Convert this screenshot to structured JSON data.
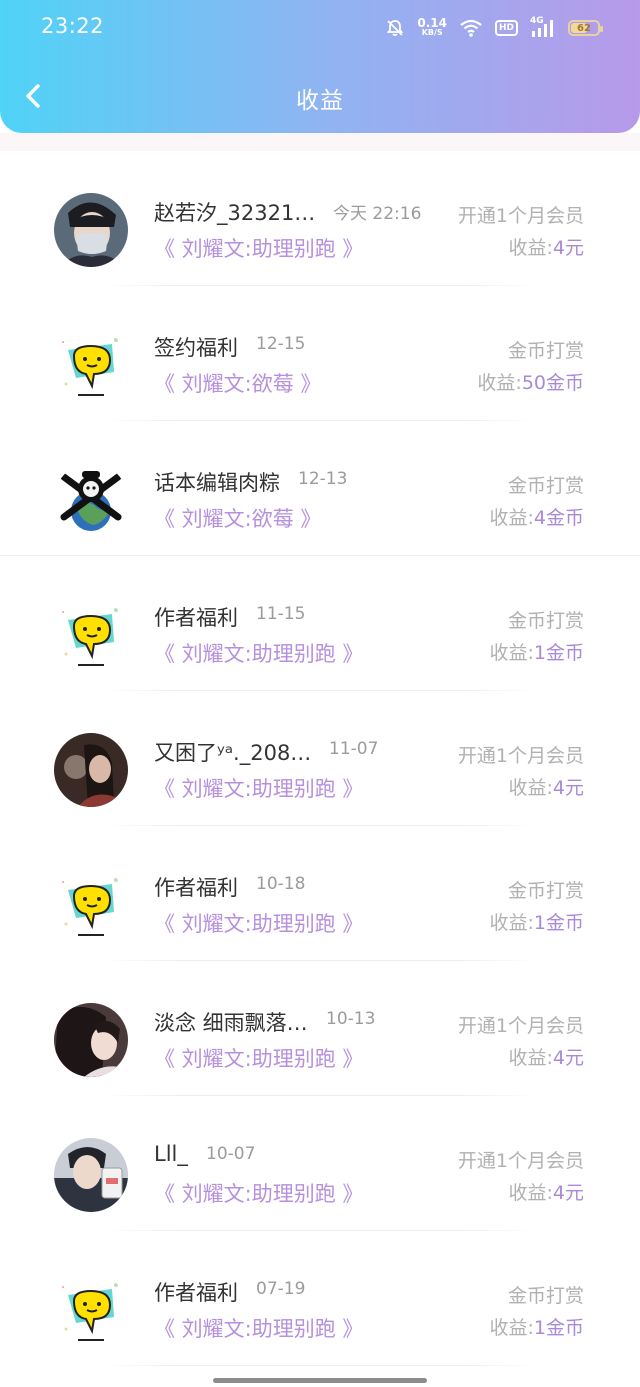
{
  "status_bar": {
    "time": "23:22",
    "speed_value": "0.14",
    "speed_unit": "KB/S",
    "hd": "HD",
    "network": "4G",
    "battery": "62"
  },
  "header": {
    "title": "收益",
    "back_icon": "chevron-left-icon"
  },
  "colors": {
    "header_gradient": [
      "#4fd3f6",
      "#b79ae9"
    ],
    "book": "#b690dd",
    "income_value": "#a98ad8"
  },
  "income_label": "收益:",
  "items": [
    {
      "avatar": "user-photo-masked-boy",
      "name": "赵若汐_32321…",
      "date": "今天  22:16",
      "type": "开通1个月会员",
      "book": "《 刘耀文:助理别跑 》",
      "income": "4元"
    },
    {
      "avatar": "chat-bubble-logo",
      "name": "签约福利",
      "date": "12-15",
      "type": "金币打赏",
      "book": "《 刘耀文:欲莓 》",
      "income": "50金币"
    },
    {
      "avatar": "skull-earth-art",
      "name": "话本编辑肉粽",
      "date": "12-13",
      "type": "金币打赏",
      "book": "《 刘耀文:欲莓 》",
      "income": "4金币"
    },
    {
      "avatar": "chat-bubble-logo",
      "name": "作者福利",
      "date": "11-15",
      "type": "金币打赏",
      "book": "《 刘耀文:助理别跑 》",
      "income": "1金币"
    },
    {
      "avatar": "user-photo-girl-dark",
      "name": "又困了ʸᵃ._208…",
      "date": "11-07",
      "type": "开通1个月会员",
      "book": "《 刘耀文:助理别跑 》",
      "income": "4元"
    },
    {
      "avatar": "chat-bubble-logo",
      "name": "作者福利",
      "date": "10-18",
      "type": "金币打赏",
      "book": "《 刘耀文:助理别跑 》",
      "income": "1金币"
    },
    {
      "avatar": "user-photo-girl-side",
      "name": "淡念  细雨飘落…",
      "date": "10-13",
      "type": "开通1个月会员",
      "book": "《 刘耀文:助理别跑 》",
      "income": "4元"
    },
    {
      "avatar": "user-photo-boy-mirror",
      "name": "Lll_",
      "date": "10-07",
      "type": "开通1个月会员",
      "book": "《 刘耀文:助理别跑 》",
      "income": "4元"
    },
    {
      "avatar": "chat-bubble-logo",
      "name": "作者福利",
      "date": "07-19",
      "type": "金币打赏",
      "book": "《 刘耀文:助理别跑 》",
      "income": "1金币"
    }
  ]
}
